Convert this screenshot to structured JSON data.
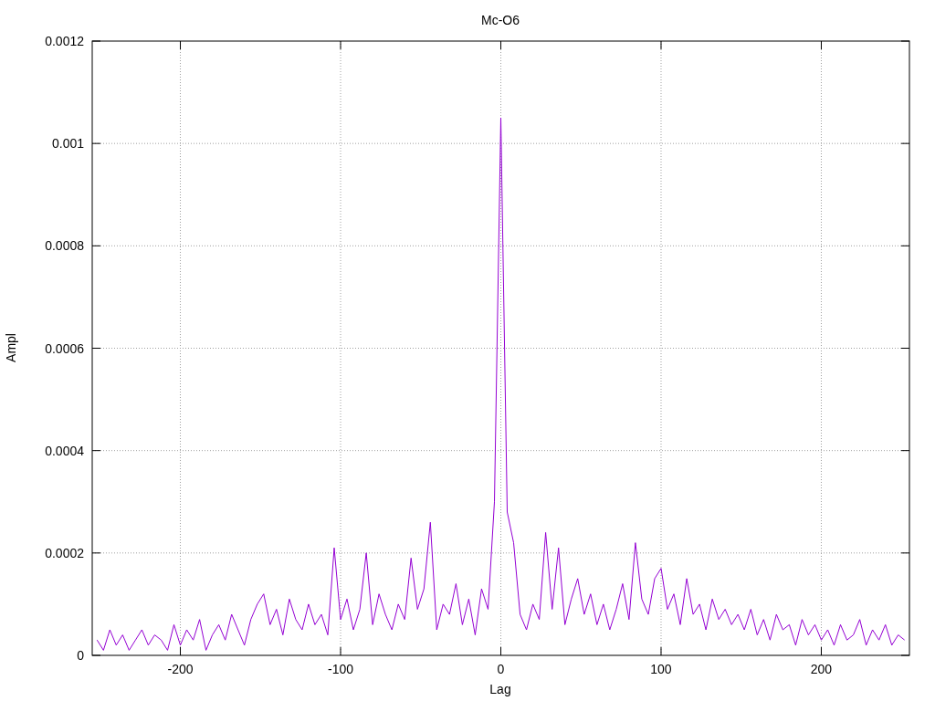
{
  "chart_data": {
    "type": "line",
    "grid": true,
    "title": "Mc-O6",
    "xlabel": "Lag",
    "ylabel": "Ampl",
    "xlim": [
      -255,
      255
    ],
    "ylim": [
      0,
      0.0012
    ],
    "xticks": [
      -200,
      -100,
      0,
      100,
      200
    ],
    "yticks": [
      {
        "value": 0,
        "label": "0"
      },
      {
        "value": 0.0002,
        "label": "0.0002"
      },
      {
        "value": 0.0004,
        "label": "0.0004"
      },
      {
        "value": 0.0006,
        "label": "0.0006"
      },
      {
        "value": 0.0008,
        "label": "0.0008"
      },
      {
        "value": 0.001,
        "label": "0.001"
      },
      {
        "value": 0.0012,
        "label": "0.0012"
      }
    ],
    "x": [
      -252,
      -248,
      -244,
      -240,
      -236,
      -232,
      -228,
      -224,
      -220,
      -216,
      -212,
      -208,
      -204,
      -200,
      -196,
      -192,
      -188,
      -184,
      -180,
      -176,
      -172,
      -168,
      -164,
      -160,
      -156,
      -152,
      -148,
      -144,
      -140,
      -136,
      -132,
      -128,
      -124,
      -120,
      -116,
      -112,
      -108,
      -104,
      -100,
      -96,
      -92,
      -88,
      -84,
      -80,
      -76,
      -72,
      -68,
      -64,
      -60,
      -56,
      -52,
      -48,
      -44,
      -40,
      -36,
      -32,
      -28,
      -24,
      -20,
      -16,
      -12,
      -8,
      -4,
      0,
      4,
      8,
      12,
      16,
      20,
      24,
      28,
      32,
      36,
      40,
      44,
      48,
      52,
      56,
      60,
      64,
      68,
      72,
      76,
      80,
      84,
      88,
      92,
      96,
      100,
      104,
      108,
      112,
      116,
      120,
      124,
      128,
      132,
      136,
      140,
      144,
      148,
      152,
      156,
      160,
      164,
      168,
      172,
      176,
      180,
      184,
      188,
      192,
      196,
      200,
      204,
      208,
      212,
      216,
      220,
      224,
      228,
      232,
      236,
      240,
      244,
      248,
      252
    ],
    "series": [
      {
        "color": "#9400d3",
        "values": [
          3e-05,
          1e-05,
          5e-05,
          2e-05,
          4e-05,
          1e-05,
          3e-05,
          5e-05,
          2e-05,
          4e-05,
          3e-05,
          1e-05,
          6e-05,
          2e-05,
          5e-05,
          3e-05,
          7e-05,
          1e-05,
          4e-05,
          6e-05,
          3e-05,
          8e-05,
          5e-05,
          2e-05,
          7e-05,
          0.0001,
          0.00012,
          6e-05,
          9e-05,
          4e-05,
          0.00011,
          7e-05,
          5e-05,
          0.0001,
          6e-05,
          8e-05,
          4e-05,
          0.00021,
          7e-05,
          0.00011,
          5e-05,
          9e-05,
          0.0002,
          6e-05,
          0.00012,
          8e-05,
          5e-05,
          0.0001,
          7e-05,
          0.00019,
          9e-05,
          0.00013,
          0.00026,
          5e-05,
          0.0001,
          8e-05,
          0.00014,
          6e-05,
          0.00011,
          4e-05,
          0.00013,
          9e-05,
          0.0003,
          0.00105,
          0.00028,
          0.00022,
          8e-05,
          5e-05,
          0.0001,
          7e-05,
          0.00024,
          9e-05,
          0.00021,
          6e-05,
          0.00011,
          0.00015,
          8e-05,
          0.00012,
          6e-05,
          0.0001,
          5e-05,
          9e-05,
          0.00014,
          7e-05,
          0.00022,
          0.00011,
          8e-05,
          0.00015,
          0.00017,
          9e-05,
          0.00012,
          6e-05,
          0.00015,
          8e-05,
          0.0001,
          5e-05,
          0.00011,
          7e-05,
          9e-05,
          6e-05,
          8e-05,
          5e-05,
          9e-05,
          4e-05,
          7e-05,
          3e-05,
          8e-05,
          5e-05,
          6e-05,
          2e-05,
          7e-05,
          4e-05,
          6e-05,
          3e-05,
          5e-05,
          2e-05,
          6e-05,
          3e-05,
          4e-05,
          7e-05,
          2e-05,
          5e-05,
          3e-05,
          6e-05,
          2e-05,
          4e-05,
          3e-05
        ]
      }
    ]
  }
}
